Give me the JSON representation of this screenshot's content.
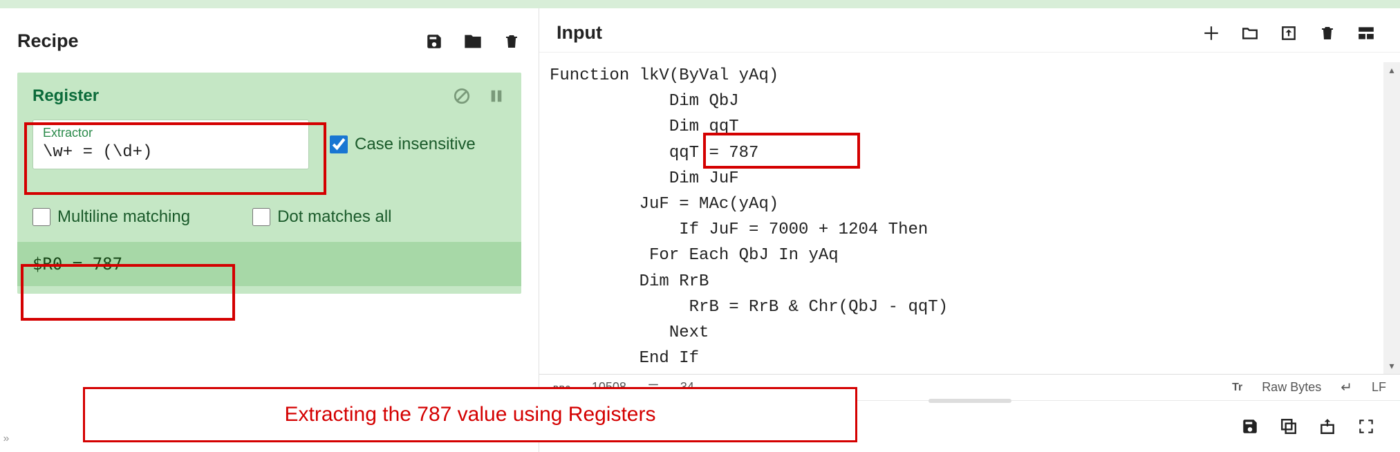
{
  "recipe": {
    "title": "Recipe",
    "operation": {
      "name": "Register",
      "extractor_label": "Extractor",
      "extractor_value": "\\w+ = (\\d+)",
      "case_insensitive_label": "Case insensitive",
      "case_insensitive_checked": true,
      "multiline_label": "Multiline matching",
      "multiline_checked": false,
      "dot_all_label": "Dot matches all",
      "dot_all_checked": false,
      "result": "$R0 = 787"
    }
  },
  "input": {
    "title": "Input",
    "code": "Function lkV(ByVal yAq)\n            Dim QbJ\n            Dim qqT\n            qqT = 787\n            Dim JuF\n         JuF = MAc(yAq)\n             If JuF = 7000 + 1204 Then\n          For Each QbJ In yAq\n         Dim RrB\n              RrB = RrB & Chr(QbJ - qqT)\n            Next\n         End If",
    "status": {
      "chars": "10508",
      "lines": "34",
      "raw_bytes": "Raw Bytes",
      "eol": "LF"
    }
  },
  "annotation": {
    "text": "Extracting the 787 value using Registers"
  }
}
